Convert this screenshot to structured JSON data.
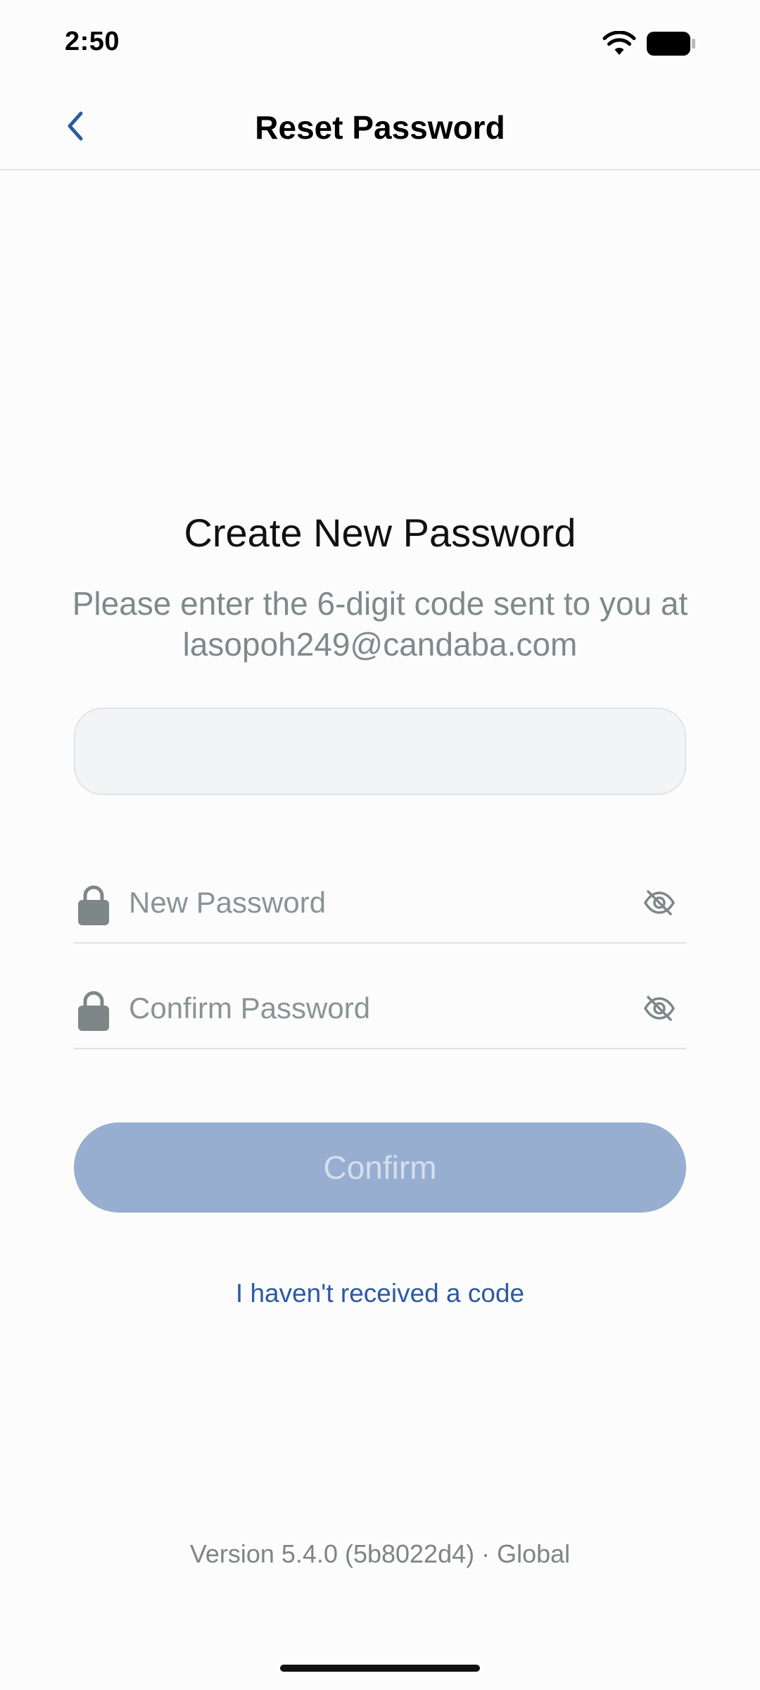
{
  "status_bar": {
    "time": "2:50",
    "wifi_icon": "wifi-icon",
    "battery_icon": "battery-icon"
  },
  "nav": {
    "back_icon": "chevron-left-icon",
    "title": "Reset Password"
  },
  "main": {
    "heading": "Create New Password",
    "subtitle": "Please enter the 6-digit code sent to you at lasopoh249@candaba.com",
    "code_input": {
      "value": "",
      "placeholder": ""
    },
    "new_password": {
      "placeholder": "New Password",
      "value": "",
      "lock_icon": "lock-icon",
      "visibility_icon": "eye-off-icon"
    },
    "confirm_password": {
      "placeholder": "Confirm Password",
      "value": "",
      "lock_icon": "lock-icon",
      "visibility_icon": "eye-off-icon"
    },
    "confirm_button": "Confirm",
    "resend_link": "I haven't received a code"
  },
  "footer": {
    "version": "Version 5.4.0 (5b8022d4) · Global"
  },
  "colors": {
    "accent": "#2d5aa0",
    "button_disabled": "#97aed1",
    "muted_text": "#7e8a8a",
    "field_background": "#f3f4f5"
  }
}
